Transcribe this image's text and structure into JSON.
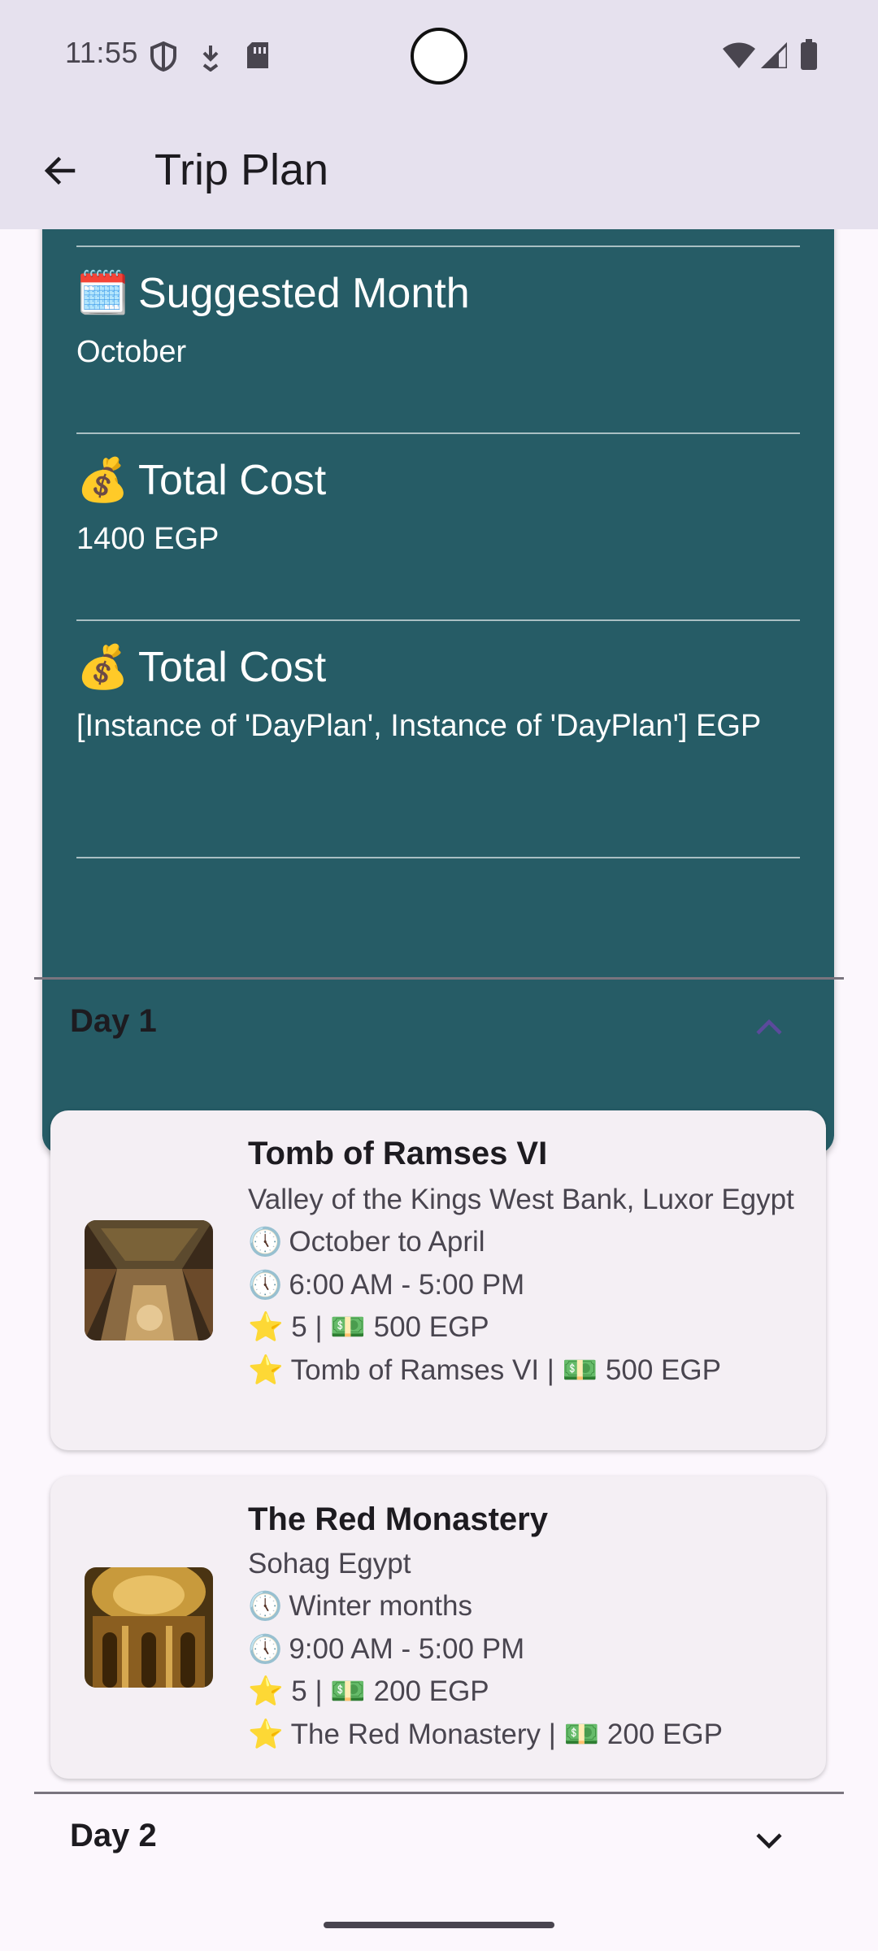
{
  "status_bar": {
    "time": "11:55",
    "icons": [
      "shield-icon",
      "download-icon",
      "sim-card-icon",
      "wifi-icon",
      "signal-icon",
      "battery-icon"
    ]
  },
  "app_bar": {
    "title": "Trip Plan",
    "back_icon": "arrow-back-icon"
  },
  "summary": {
    "items": [
      {
        "emoji": "🗓️",
        "heading": "Suggested Month",
        "value": "October"
      },
      {
        "emoji": "💰",
        "heading": "Total Cost",
        "value": "1400 EGP"
      },
      {
        "emoji": "💰",
        "heading": "Total Cost",
        "value": "[Instance of 'DayPlan', Instance of 'DayPlan'] EGP"
      }
    ],
    "colors": {
      "card_bg": "#265c66",
      "text": "#ffffff"
    }
  },
  "days": [
    {
      "label": "Day 1",
      "expanded": true,
      "chevron": "chevron-up-icon",
      "places": [
        {
          "name": "Tomb of Ramses VI",
          "location": "Valley of the Kings West Bank, Luxor Egypt",
          "season_emoji": "🕔",
          "season": "October to April",
          "hours_emoji": "🕔",
          "hours": "6:00 AM - 5:00 PM",
          "rating_line": "⭐ 5 | 💵 500 EGP",
          "summary_line": "⭐ Tomb of Ramses VI | 💵 500 EGP"
        },
        {
          "name": "The Red Monastery",
          "location": "Sohag Egypt",
          "season_emoji": "🕔",
          "season": "Winter months",
          "hours_emoji": "🕔",
          "hours": "9:00 AM - 5:00 PM",
          "rating_line": "⭐ 5 | 💵 200 EGP",
          "summary_line": "⭐ The Red Monastery | 💵 200 EGP"
        }
      ]
    },
    {
      "label": "Day 2",
      "expanded": false,
      "chevron": "chevron-down-icon"
    }
  ],
  "colors": {
    "accent": "#5b4a9c",
    "app_bar_bg": "#e6e1ee",
    "page_bg": "#fcf7fd"
  }
}
